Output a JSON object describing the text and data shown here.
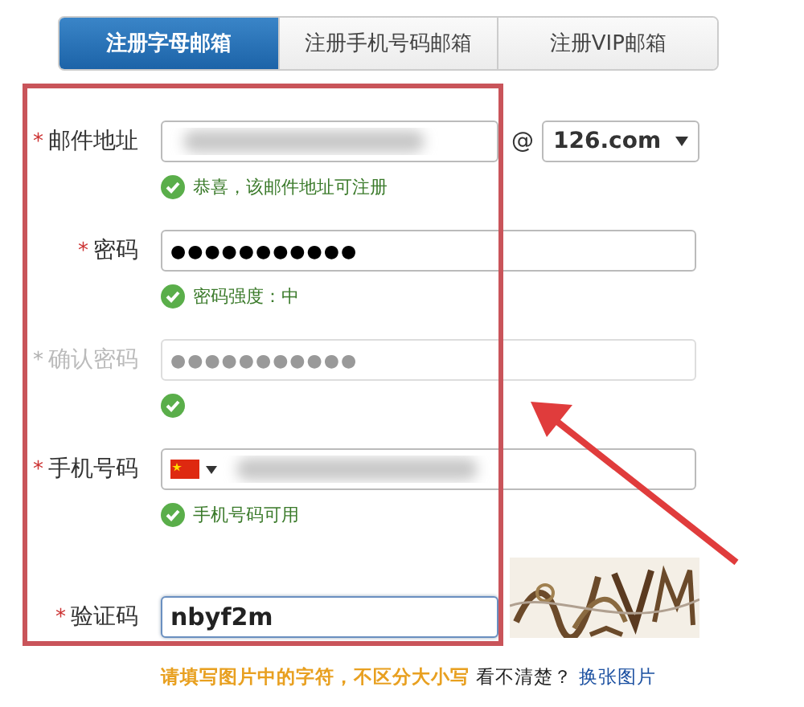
{
  "tabs": [
    {
      "label": "注册字母邮箱",
      "selected": true
    },
    {
      "label": "注册手机号码邮箱",
      "selected": false
    },
    {
      "label": "注册VIP邮箱",
      "selected": false
    }
  ],
  "form": {
    "rows": [
      {
        "kind": "email",
        "label": "邮件地址",
        "required_mark": "*",
        "faded": false,
        "blurred": true,
        "at": "@",
        "domain": "126.com",
        "hint": "恭喜，该邮件地址可注册",
        "valid": true
      },
      {
        "kind": "text",
        "label": "密码",
        "required_mark": "*",
        "faded": false,
        "value": "●●●●●●●●●●●",
        "hint": "密码强度：中",
        "valid": true
      },
      {
        "kind": "text",
        "label": "确认密码",
        "required_mark": "*",
        "faded": true,
        "value": "●●●●●●●●●●●",
        "valid": true
      },
      {
        "kind": "phone",
        "label": "手机号码",
        "required_mark": "*",
        "faded": false,
        "blurred": true,
        "hint": "手机号码可用",
        "valid": true
      },
      {
        "kind": "captcha",
        "label": "验证码",
        "required_mark": "*",
        "faded": false,
        "value": "nbyf2m",
        "focused": true
      }
    ],
    "captcha_hint": "请填写图片中的字符，不区分大小写",
    "unclear": "看不清楚？",
    "refresh_link": "换张图片"
  },
  "annotation": {
    "highlight_box": true,
    "arrow": true
  }
}
